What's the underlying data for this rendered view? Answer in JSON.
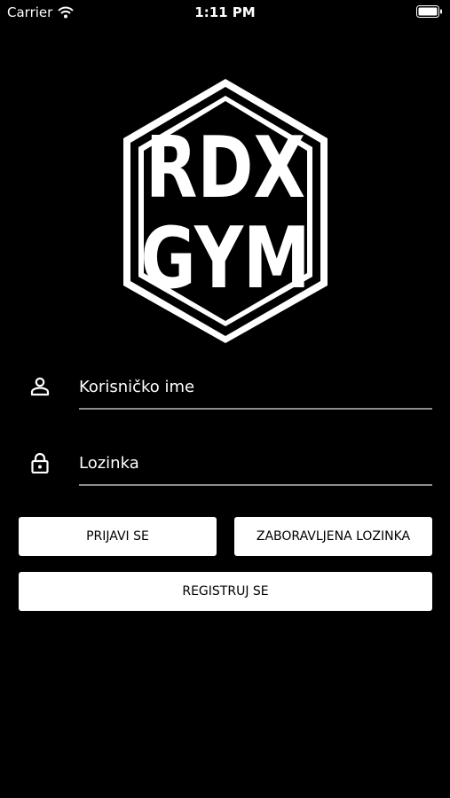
{
  "status_bar": {
    "carrier": "Carrier",
    "time": "1:11 PM",
    "wifi_icon": "wifi-icon",
    "battery_icon": "battery-icon"
  },
  "logo": {
    "line1": "RDX",
    "line2": "GYM"
  },
  "login_form": {
    "username": {
      "placeholder": "Korisničko ime",
      "value": "",
      "icon": "user-icon"
    },
    "password": {
      "placeholder": "Lozinka",
      "value": "",
      "icon": "lock-icon"
    }
  },
  "buttons": {
    "login": "PRIJAVI SE",
    "forgot_password": "ZABORAVLJENA LOZINKA",
    "register": "REGISTRUJ SE"
  },
  "colors": {
    "background": "#000000",
    "button_background": "#ffffff",
    "button_text": "#000000",
    "input_underline": "#8e8e8e"
  }
}
